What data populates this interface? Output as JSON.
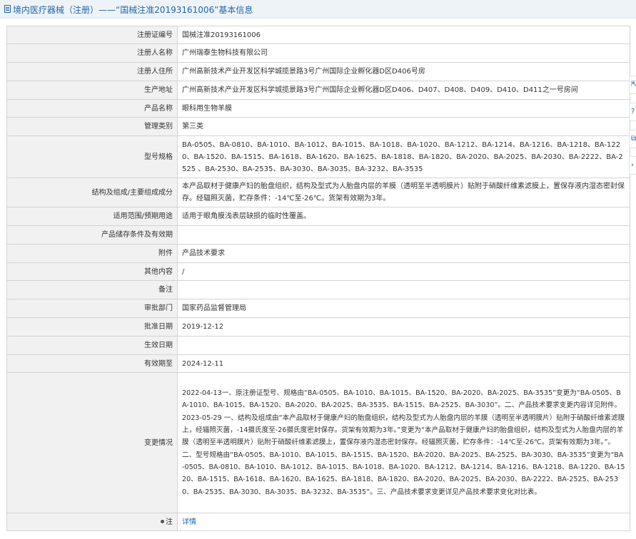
{
  "header": {
    "title": "境内医疗器械（注册）——“国械注准20193161006”基本信息",
    "icon": "document-icon"
  },
  "rows": [
    {
      "label": "注册证编号",
      "value": "国械注准20193161006"
    },
    {
      "label": "注册人名称",
      "value": "广州瑞泰生物科技有限公司"
    },
    {
      "label": "注册人住所",
      "value": "广州高新技术产业开发区科学城揽景路3号广州国际企业孵化器D区D406号房"
    },
    {
      "label": "生产地址",
      "value": "广州高新技术产业开发区科学城揽景路3号广州国际企业孵化器D区D406、D407、D408、D409、D410、D411之一号房间"
    },
    {
      "label": "产品名称",
      "value": "眼科用生物羊膜"
    },
    {
      "label": "管理类别",
      "value": "第三类"
    },
    {
      "label": "型号规格",
      "value": "BA-0505、BA-0810、BA-1010、BA-1012、BA-1015、BA-1018、BA-1020、BA-1212、BA-1214、BA-1216、BA-1218、BA-1220、BA-1520、BA-1515、BA-1618、BA-1620、BA-1625、BA-1818、BA-1820、BA-2020、BA-2025、BA-2030、BA-2222、BA-2525 、BA-2530、BA-2535、BA-3030、BA-3035、BA-3232、BA-3535"
    },
    {
      "label": "结构及组成/主要组成成分",
      "value": "本产品取材于健康产妇的胎盘组织，结构及型式为人胎盘内层的羊膜（透明至半透明膜片）贴附于硝酸纤维素滤膜上，置保存液内湿态密封保存。经辐照灭菌，贮存条件：-14℃至-26℃。货架有效期为3年。"
    },
    {
      "label": "适用范围/预期用途",
      "value": "适用于眼角膜浅表层缺损的临时性覆盖。"
    },
    {
      "label": "产品储存条件及有效期",
      "value": ""
    },
    {
      "label": "附件",
      "value": "产品技术要求"
    },
    {
      "label": "其他内容",
      "value": "/"
    },
    {
      "label": "备注",
      "value": ""
    },
    {
      "label": "审批部门",
      "value": "国家药品监督管理局"
    },
    {
      "label": "批准日期",
      "value": "2019-12-12"
    },
    {
      "label": "生效日期",
      "value": ""
    },
    {
      "label": "有效期至",
      "value": "2024-12-11"
    },
    {
      "label": "变更情况",
      "value": "2022-04-13一、原注册证型号、规格由“BA-0505、BA-1010、BA-1015、BA-1520、BA-2020、BA-2025、BA-3535”变更为“BA-0505、BA-1010、BA-1015、BA-1520、BA-2020、BA-2025、BA-3535、BA-1515、BA-2525、BA-3030”。二、产品技术要求变更内容详见附件。\n2023-05-29 一、结构及组成由“本产品取材于健康产妇的胎盘组织，结构及型式为人胎盘内层的羊膜（透明至半透明膜片）贴附于硝酸纤维素滤膜上，经辐照灭菌，-14摄氏度至-26摄氏度密封保存。货架有效期为3年。”变更为“本产品取材于健康产妇的胎盘组织，结构及型式为人胎盘内层的羊膜（透明至半透明膜片）贴附于硝酸纤维素滤膜上，置保存液内湿态密封保存。经辐照灭菌，贮存条件：-14℃至-26℃。货架有效期为3年。”。二、型号规格由“BA-0505、BA-1010、BA-1015、BA-1515、BA-1520、BA-2020、BA-2025、BA-2525、BA-3030、BA-3535”变更为“BA-0505、BA-0810、BA-1010、BA-1012、BA-1015、BA-1018、BA-1020、BA-1212、BA-1214、BA-1216、BA-1218、BA-1220、BA-1520、BA-1515、BA-1618、BA-1620、BA-1625、BA-1818、BA-1820、BA-2020、BA-2025、BA-2030、BA-2222、BA-2525、BA-2530、BA-2535、BA-3030、BA-3035、BA-3232、BA-3535”。三、产品技术要求变更详见产品技术要求变化对比表。"
    }
  ],
  "note": {
    "label": "注",
    "link_text": "详情",
    "icon": "bullet-icon"
  },
  "side_buttons": [
    {
      "icon": "share-icon",
      "glyph": "⇱"
    },
    {
      "icon": "help-icon",
      "glyph": "?"
    },
    {
      "icon": "copy-icon",
      "glyph": "⧉"
    },
    {
      "icon": "chevron-right-icon",
      "glyph": "›"
    }
  ]
}
